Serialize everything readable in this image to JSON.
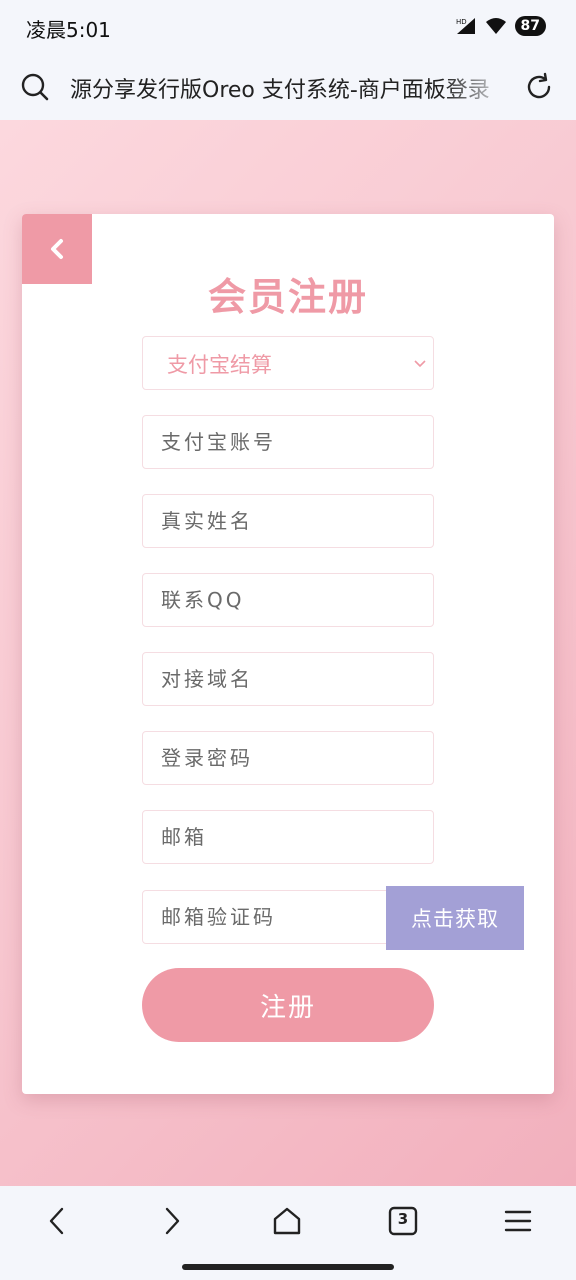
{
  "status_bar": {
    "time": "凌晨5:01",
    "battery": "87"
  },
  "address_bar": {
    "url": "源分享发行版Oreo 支付系统-商户面板登录"
  },
  "card": {
    "title": "会员注册",
    "settlement_select": {
      "value": "支付宝结算"
    },
    "fields": {
      "alipay_account": "支付宝账号",
      "real_name": "真实姓名",
      "contact_qq": "联系QQ",
      "domain": "对接域名",
      "password": "登录密码",
      "email": "邮箱",
      "email_code": "邮箱验证码"
    },
    "get_code_label": "点击获取",
    "register_label": "注册"
  },
  "bottom_nav": {
    "tab_count": "3"
  },
  "colors": {
    "accent": "#ef9aa6",
    "secondary": "#a3a0d6"
  }
}
